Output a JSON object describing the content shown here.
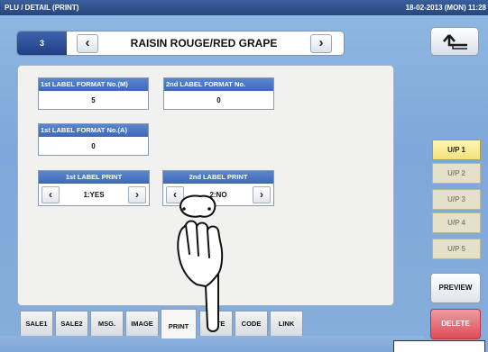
{
  "window": {
    "title": "PLU / DETAIL (PRINT)",
    "datetime": "18-02-2013 (MON) 11:28"
  },
  "header": {
    "plu_number": "3",
    "prev_icon": "chevron-left-icon",
    "next_icon": "chevron-right-icon",
    "item_name": "RAISIN ROUGE/RED GRAPE",
    "back_icon": "return-arrow-icon"
  },
  "fields": {
    "first_label_format_m": {
      "label": "1st LABEL FORMAT No.(M)",
      "value": "5"
    },
    "second_label_format": {
      "label": "2nd LABEL FORMAT No.",
      "value": "0"
    },
    "first_label_format_a": {
      "label": "1st LABEL FORMAT No.(A)",
      "value": "0"
    },
    "first_label_print": {
      "label": "1st LABEL PRINT",
      "value": "1:YES"
    },
    "second_label_print": {
      "label": "2nd LABEL PRINT",
      "value": "2:NO"
    }
  },
  "side_buttons": [
    "U/P 1",
    "U/P 2",
    "U/P 3",
    "U/P 4",
    "U/P 5"
  ],
  "side_active_index": 0,
  "actions": {
    "preview": "PREVIEW",
    "delete": "DELETE"
  },
  "tabs": [
    "SALE1",
    "SALE2",
    "MSG.",
    "IMAGE",
    "PRINT",
    "DATE",
    "CODE",
    "LINK"
  ],
  "active_tab": "PRINT",
  "colors": {
    "title_bar": "#2f5290",
    "panel": "#86aedc",
    "label_header": "#4a76c3",
    "active_side_button": "#f4e68a",
    "delete": "#de4b57"
  },
  "overlay": {
    "hand_icon": "pointing-hand-icon"
  }
}
